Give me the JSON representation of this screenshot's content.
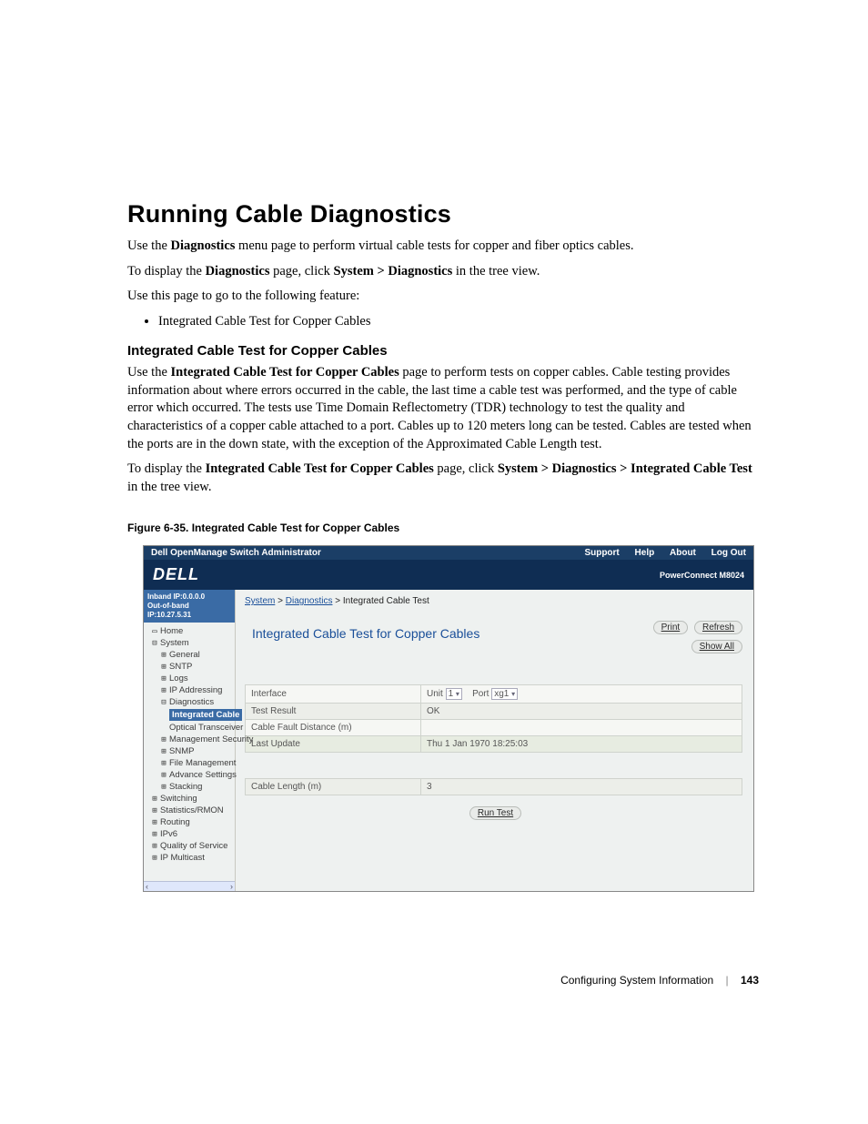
{
  "doc": {
    "heading": "Running Cable Diagnostics",
    "p1_a": "Use the ",
    "p1_bold": "Diagnostics",
    "p1_b": " menu page to perform virtual cable tests for copper and fiber optics cables.",
    "p2_a": "To display the ",
    "p2_bold": "Diagnostics",
    "p2_b": " page, click ",
    "p2_path": "System > Diagnostics",
    "p2_c": " in the tree view.",
    "p3": "Use this page to go to the following feature:",
    "bullet1": "Integrated Cable Test for Copper Cables",
    "subhead": "Integrated Cable Test for Copper Cables",
    "p4_a": "Use the ",
    "p4_bold": "Integrated Cable Test for Copper Cables",
    "p4_b": " page to perform tests on copper cables. Cable testing provides information about where errors occurred in the cable, the last time a cable test was performed, and the type of cable error which occurred. The tests use Time Domain Reflectometry (TDR) technology to test the quality and characteristics of a copper cable attached to a port. Cables up to 120 meters long can be tested. Cables are tested when the ports are in the down state, with the exception of the Approximated Cable Length test.",
    "p5_a": "To display the ",
    "p5_bold": "Integrated Cable Test for Copper Cables",
    "p5_b": " page, click ",
    "p5_path": "System > Diagnostics > Integrated Cable Test",
    "p5_c": " in the tree view.",
    "fig_caption": "Figure 6-35.    Integrated Cable Test for Copper Cables",
    "footer_section": "Configuring System Information",
    "footer_page": "143"
  },
  "ui": {
    "topbar_title": "Dell OpenManage Switch Administrator",
    "topbar_links": {
      "support": "Support",
      "help": "Help",
      "about": "About",
      "logout": "Log Out"
    },
    "brand_logo": "DELL",
    "brand_model": "PowerConnect M8024",
    "ip_line1": "Inband IP:0.0.0.0",
    "ip_line2": "Out-of-band IP:10.27.5.31",
    "tree": {
      "home": "Home",
      "system": "System",
      "general": "General",
      "sntp": "SNTP",
      "logs": "Logs",
      "ip_addressing": "IP Addressing",
      "diagnostics": "Diagnostics",
      "integrated_cable": "Integrated Cable",
      "optical": "Optical Transceiver",
      "mgmt_security": "Management Security",
      "snmp": "SNMP",
      "file_mgmt": "File Management",
      "advance": "Advance Settings",
      "stacking": "Stacking",
      "switching": "Switching",
      "stats": "Statistics/RMON",
      "routing": "Routing",
      "ipv6": "IPv6",
      "qos": "Quality of Service",
      "ipmulticast": "IP Multicast"
    },
    "breadcrumb": {
      "l1": "System",
      "l2": "Diagnostics",
      "l3": "Integrated Cable Test",
      "sep": " > "
    },
    "panel_title": "Integrated Cable Test for Copper Cables",
    "buttons": {
      "print": "Print",
      "refresh": "Refresh",
      "showall": "Show All",
      "runtest": "Run Test"
    },
    "rows": {
      "interface": "Interface",
      "unit_lbl": "Unit",
      "unit_val": "1",
      "port_lbl": "Port",
      "port_val": "xg1",
      "test_result": "Test Result",
      "test_result_val": "OK",
      "fault_dist": "Cable Fault Distance (m)",
      "fault_dist_val": "",
      "last_update": "Last Update",
      "last_update_val": "Thu 1 Jan 1970 18:25:03",
      "cable_len": "Cable Length (m)",
      "cable_len_val": "3"
    }
  },
  "chart_data": {
    "type": "table",
    "title": "Integrated Cable Test for Copper Cables",
    "rows": [
      {
        "label": "Interface",
        "value": "Unit 1  Port xg1"
      },
      {
        "label": "Test Result",
        "value": "OK"
      },
      {
        "label": "Cable Fault Distance (m)",
        "value": ""
      },
      {
        "label": "Last Update",
        "value": "Thu 1 Jan 1970 18:25:03"
      },
      {
        "label": "Cable Length (m)",
        "value": "3"
      }
    ]
  }
}
